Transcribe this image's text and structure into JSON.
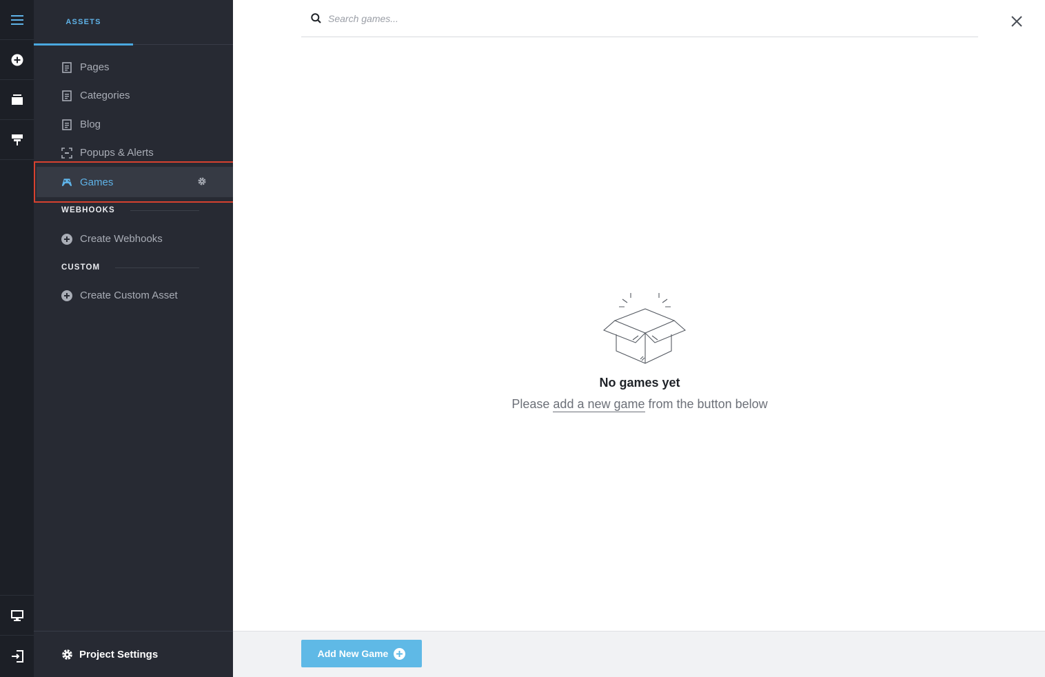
{
  "rail": {
    "items": [
      {
        "icon": "hamburger-menu-icon"
      },
      {
        "icon": "add-circle-icon"
      },
      {
        "icon": "layers-icon"
      },
      {
        "icon": "plug-icon"
      },
      {
        "icon": "desktop-icon"
      },
      {
        "icon": "exit-icon"
      }
    ]
  },
  "panel": {
    "tab_label": "ASSETS",
    "items": [
      {
        "label": "Pages",
        "icon": "page-icon"
      },
      {
        "label": "Categories",
        "icon": "page-icon"
      },
      {
        "label": "Blog",
        "icon": "page-icon"
      },
      {
        "label": "Popups & Alerts",
        "icon": "popup-icon"
      },
      {
        "label": "Games",
        "icon": "gamepad-icon",
        "active": true
      }
    ],
    "webhooks_header": "WEBHOOKS",
    "create_webhooks": "Create Webhooks",
    "custom_header": "CUSTOM",
    "create_custom": "Create Custom Asset",
    "footer_label": "Project Settings"
  },
  "main": {
    "search_placeholder": "Search games...",
    "empty_title": "No games yet",
    "empty_pre": "Please ",
    "empty_link": "add a new game",
    "empty_post": " from the button below",
    "add_button": "Add New Game"
  },
  "colors": {
    "accent": "#5fb3e8",
    "highlight": "#d8412f",
    "rail_bg": "#1c1f26",
    "panel_bg": "#272a33"
  }
}
